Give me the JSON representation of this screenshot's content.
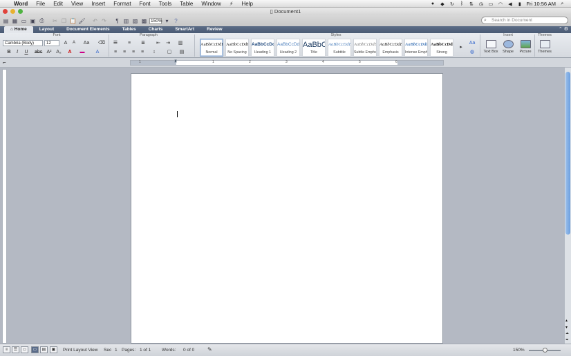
{
  "menubar": {
    "apple_glyph": "",
    "app_name": "Word",
    "items": [
      "File",
      "Edit",
      "View",
      "Insert",
      "Format",
      "Font",
      "Tools",
      "Table",
      "Window",
      "⚡",
      "Help"
    ],
    "clock": "Fri 10:56 AM"
  },
  "window": {
    "title": "Document1"
  },
  "toolbar": {
    "zoom": "150%",
    "search_placeholder": "Search in Document"
  },
  "ribbon": {
    "tabs": [
      "Home",
      "Layout",
      "Document Elements",
      "Tables",
      "Charts",
      "SmartArt",
      "Review"
    ],
    "groups": {
      "font": "Font",
      "paragraph": "Paragraph",
      "styles": "Styles",
      "insert": "Insert",
      "themes": "Themes"
    },
    "font_name": "Cambria (Body)",
    "font_size": "12",
    "styles": [
      {
        "sample": "AaBbCcDdEe",
        "name": "Normal"
      },
      {
        "sample": "AaBbCcDdEe",
        "name": "No Spacing"
      },
      {
        "sample": "AaBbCcDc",
        "name": "Heading 1"
      },
      {
        "sample": "AaBbCcDdEe",
        "name": "Heading 2"
      },
      {
        "sample": "AaBbC(",
        "name": "Title"
      },
      {
        "sample": "AaBbCcDdE",
        "name": "Subtitle"
      },
      {
        "sample": "AaBbCcDdEe",
        "name": "Subtle Empha..."
      },
      {
        "sample": "AaBbCcDdEe",
        "name": "Emphasis"
      },
      {
        "sample": "AaBbCcDdEe",
        "name": "Intense Emph..."
      },
      {
        "sample": "AaBbCcDdE",
        "name": "Strong"
      }
    ],
    "insert_items": [
      "Text Box",
      "Shape",
      "Picture"
    ],
    "themes_label": "Themes"
  },
  "ruler": {
    "marks": [
      "1",
      "1",
      "2",
      "3",
      "4",
      "5",
      "6"
    ]
  },
  "status": {
    "view_label": "Print Layout View",
    "sec_label": "Sec",
    "sec_value": "1",
    "pages_label": "Pages:",
    "pages_value": "1 of 1",
    "words_label": "Words:",
    "words_value": "0 of 0",
    "zoom": "150%"
  },
  "colors": {
    "tabbar": "#495a74",
    "page": "#ffffff",
    "workspace": "#b4b9c3"
  }
}
